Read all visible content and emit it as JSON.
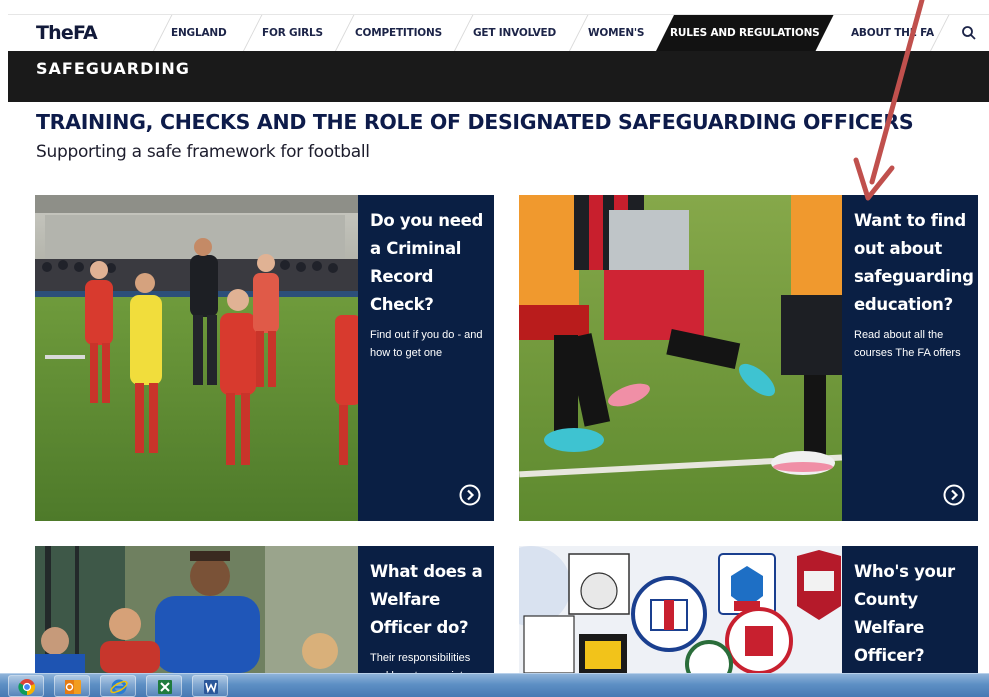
{
  "brand": {
    "logo_text": "TheFA"
  },
  "nav": {
    "items": [
      {
        "label": "ENGLAND"
      },
      {
        "label": "FOR GIRLS"
      },
      {
        "label": "COMPETITIONS"
      },
      {
        "label": "GET INVOLVED"
      },
      {
        "label": "WOMEN'S"
      },
      {
        "label": "RULES AND REGULATIONS",
        "active": true
      },
      {
        "label": "ABOUT THE FA"
      }
    ],
    "search_icon": "search-icon"
  },
  "section": {
    "title": "SAFEGUARDING"
  },
  "page": {
    "title": "TRAINING, CHECKS AND THE ROLE OF DESIGNATED SAFEGUARDING OFFICERS",
    "subtitle": "Supporting a safe  framework for football"
  },
  "cards": [
    {
      "title": "Do you need a Criminal Record Check?",
      "description": "Find out if you do - and how to get one",
      "icon": "arrow-circle-right-icon"
    },
    {
      "title": "Want to find out about safeguarding education?",
      "description": "Read about all the courses The FA offers",
      "icon": "arrow-circle-right-icon"
    },
    {
      "title": "What does a Welfare Officer do?",
      "description": "Their responsibilities and how to appoint",
      "icon": "arrow-circle-right-icon"
    },
    {
      "title": "Who's your County Welfare Officer?",
      "description": "",
      "icon": "arrow-circle-right-icon"
    }
  ],
  "taskbar": {
    "apps": [
      "chrome-icon",
      "outlook-icon",
      "internet-explorer-icon",
      "excel-icon",
      "word-icon"
    ]
  },
  "colors": {
    "navy": "#0a1f44",
    "header_black": "#1a1a1a",
    "annotation_red": "#c0504d"
  }
}
